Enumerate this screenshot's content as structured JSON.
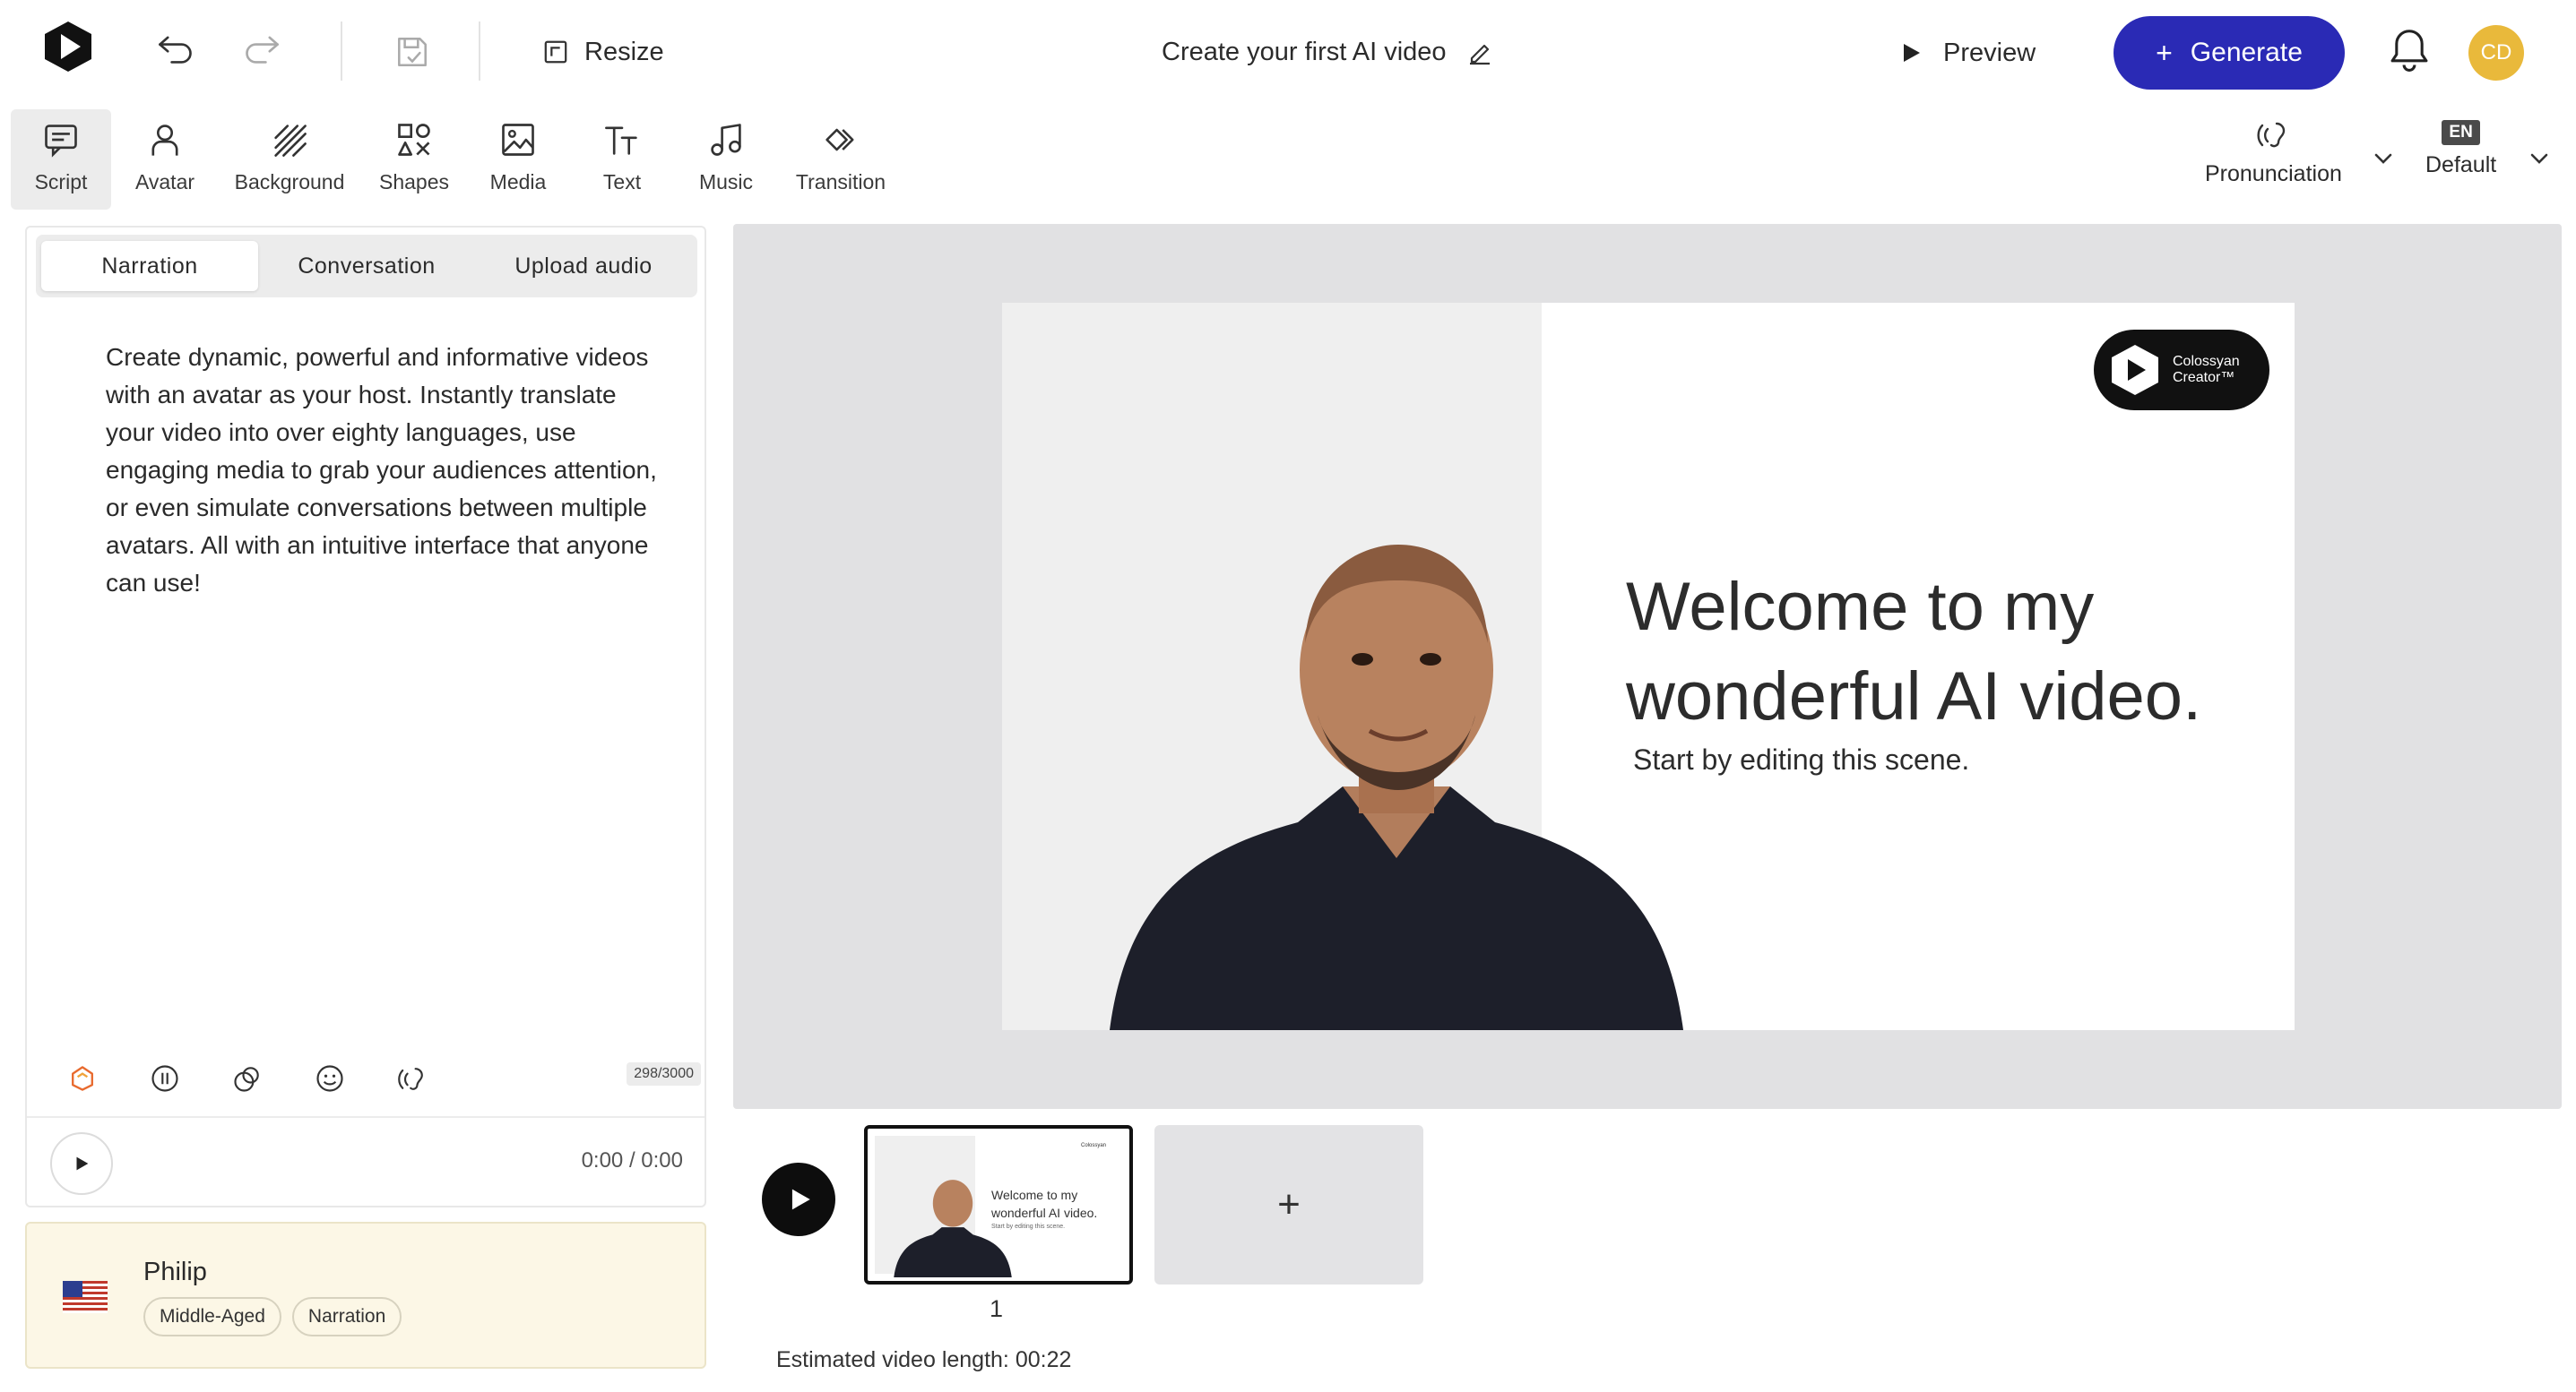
{
  "header": {
    "resize_label": "Resize",
    "project_title": "Create your first AI video",
    "preview_label": "Preview",
    "generate_label": "Generate",
    "user_initials": "CD",
    "accent_color": "#2a2ab5",
    "avatar_color": "#e9b93b"
  },
  "toolbar": {
    "items": [
      {
        "label": "Script",
        "icon": "script-icon"
      },
      {
        "label": "Avatar",
        "icon": "avatar-icon"
      },
      {
        "label": "Background",
        "icon": "background-icon"
      },
      {
        "label": "Shapes",
        "icon": "shapes-icon"
      },
      {
        "label": "Media",
        "icon": "media-icon"
      },
      {
        "label": "Text",
        "icon": "text-icon"
      },
      {
        "label": "Music",
        "icon": "music-icon"
      },
      {
        "label": "Transition",
        "icon": "transition-icon"
      }
    ],
    "pronunciation_label": "Pronunciation",
    "language_code": "EN",
    "language_label": "Default"
  },
  "script": {
    "tabs": [
      "Narration",
      "Conversation",
      "Upload audio"
    ],
    "active_tab": "Narration",
    "text": "Create dynamic, powerful and informative videos with an avatar as your host. Instantly translate your video into over eighty languages, use engaging media to grab your audiences attention, or even simulate conversations between multiple avatars. All with an intuitive interface that anyone can use!",
    "char_count": "298/3000",
    "audio_time": "0:00 / 0:00"
  },
  "voice": {
    "name": "Philip",
    "tags": [
      "Middle-Aged",
      "Narration"
    ]
  },
  "slide": {
    "brand_line1": "Colossyan",
    "brand_line2": "Creator™",
    "headline_line1": "Welcome to my",
    "headline_line2": "wonderful AI video.",
    "subline": "Start by editing this scene."
  },
  "timeline": {
    "thumb_line1": "Welcome to my",
    "thumb_line2": "wonderful AI video.",
    "thumb_sub": "Start by editing this scene.",
    "thumb_brand": "Colossyan",
    "scene_number": "1",
    "add_label": "+",
    "estimate_label": "Estimated video length:",
    "estimate_value": "00:22"
  }
}
